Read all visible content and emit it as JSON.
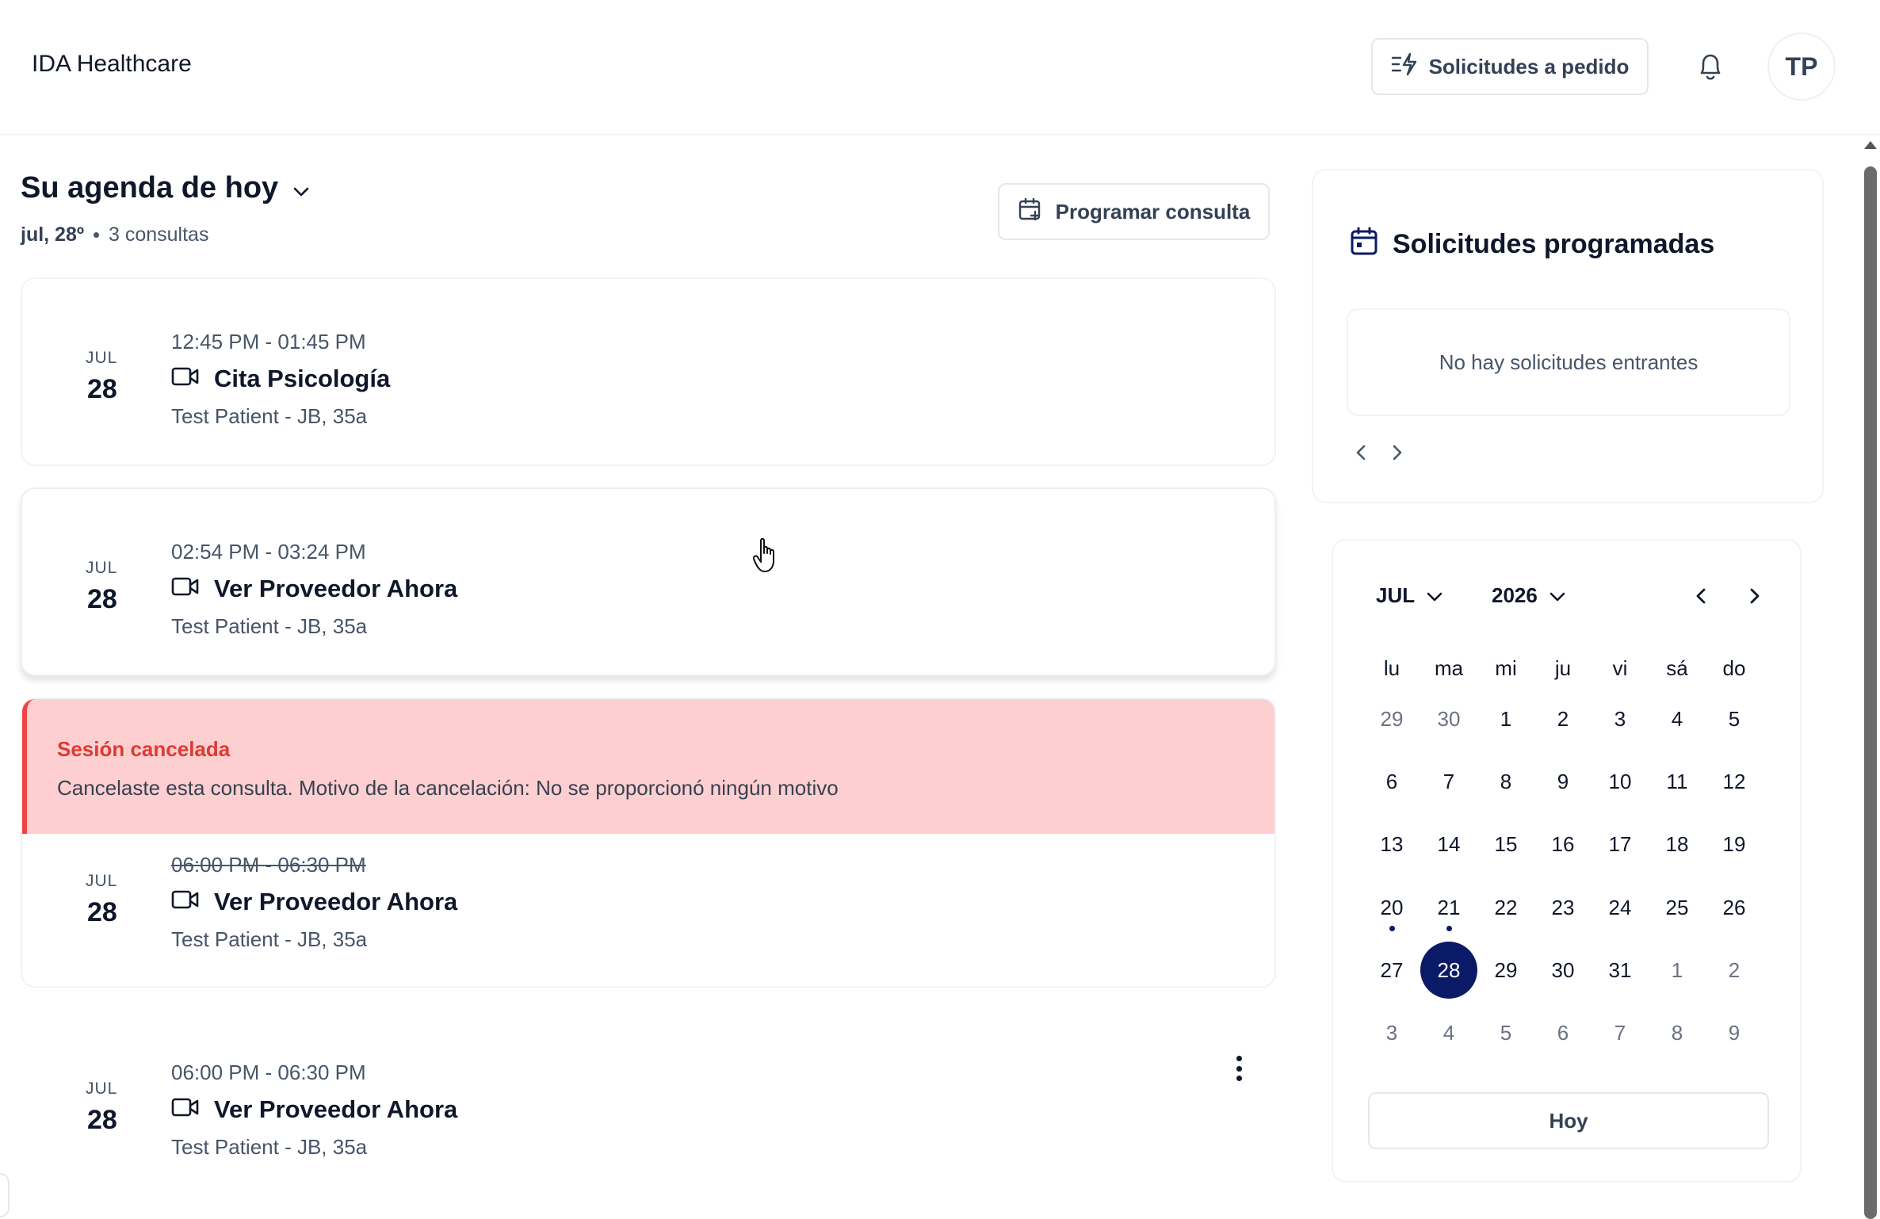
{
  "header": {
    "brand": "IDA Healthcare",
    "on_demand_label": "Solicitudes a pedido",
    "avatar_initials": "TP"
  },
  "agenda": {
    "title": "Su agenda de hoy",
    "date": "jul, 28º",
    "count": "3 consultas",
    "schedule_label": "Programar consulta"
  },
  "appointments": [
    {
      "month": "JUL",
      "day": "28",
      "time": "12:45 PM - 01:45 PM",
      "title": "Cita Psicología",
      "patient": "Test Patient - JB, 35a"
    },
    {
      "month": "JUL",
      "day": "28",
      "time": "02:54 PM - 03:24 PM",
      "title": "Ver Proveedor Ahora",
      "patient": "Test Patient - JB, 35a"
    },
    {
      "month": "JUL",
      "day": "28",
      "time": "06:00 PM - 06:30 PM",
      "title": "Ver Proveedor Ahora",
      "patient": "Test Patient - JB, 35a",
      "cancel_title": "Sesión cancelada",
      "cancel_message": "Cancelaste esta consulta. Motivo de la cancelación: No se proporcionó ningún motivo"
    },
    {
      "month": "JUL",
      "day": "28",
      "time": "06:00 PM - 06:30 PM",
      "title": "Ver Proveedor Ahora",
      "patient": "Test Patient - JB, 35a"
    }
  ],
  "requests": {
    "title": "Solicitudes programadas",
    "empty": "No hay solicitudes entrantes"
  },
  "calendar": {
    "month": "JUL",
    "year": "2026",
    "weekdays": [
      "lu",
      "ma",
      "mi",
      "ju",
      "vi",
      "sá",
      "do"
    ],
    "weeks": [
      [
        {
          "d": "29",
          "m": true
        },
        {
          "d": "30",
          "m": true
        },
        {
          "d": "1"
        },
        {
          "d": "2"
        },
        {
          "d": "3"
        },
        {
          "d": "4"
        },
        {
          "d": "5"
        }
      ],
      [
        {
          "d": "6"
        },
        {
          "d": "7"
        },
        {
          "d": "8"
        },
        {
          "d": "9"
        },
        {
          "d": "10"
        },
        {
          "d": "11"
        },
        {
          "d": "12"
        }
      ],
      [
        {
          "d": "13"
        },
        {
          "d": "14"
        },
        {
          "d": "15"
        },
        {
          "d": "16"
        },
        {
          "d": "17"
        },
        {
          "d": "18"
        },
        {
          "d": "19"
        }
      ],
      [
        {
          "d": "20",
          "ev": true
        },
        {
          "d": "21",
          "ev": true
        },
        {
          "d": "22"
        },
        {
          "d": "23"
        },
        {
          "d": "24"
        },
        {
          "d": "25"
        },
        {
          "d": "26"
        }
      ],
      [
        {
          "d": "27"
        },
        {
          "d": "28",
          "sel": true
        },
        {
          "d": "29"
        },
        {
          "d": "30"
        },
        {
          "d": "31"
        },
        {
          "d": "1",
          "m": true
        },
        {
          "d": "2",
          "m": true
        }
      ],
      [
        {
          "d": "3",
          "m": true
        },
        {
          "d": "4",
          "m": true
        },
        {
          "d": "5",
          "m": true
        },
        {
          "d": "6",
          "m": true
        },
        {
          "d": "7",
          "m": true
        },
        {
          "d": "8",
          "m": true
        },
        {
          "d": "9",
          "m": true
        }
      ]
    ],
    "today_label": "Hoy"
  },
  "colors": {
    "accent": "#0b1a66",
    "cancel_bg": "#fdcfd0",
    "cancel_text": "#dc3b33"
  }
}
